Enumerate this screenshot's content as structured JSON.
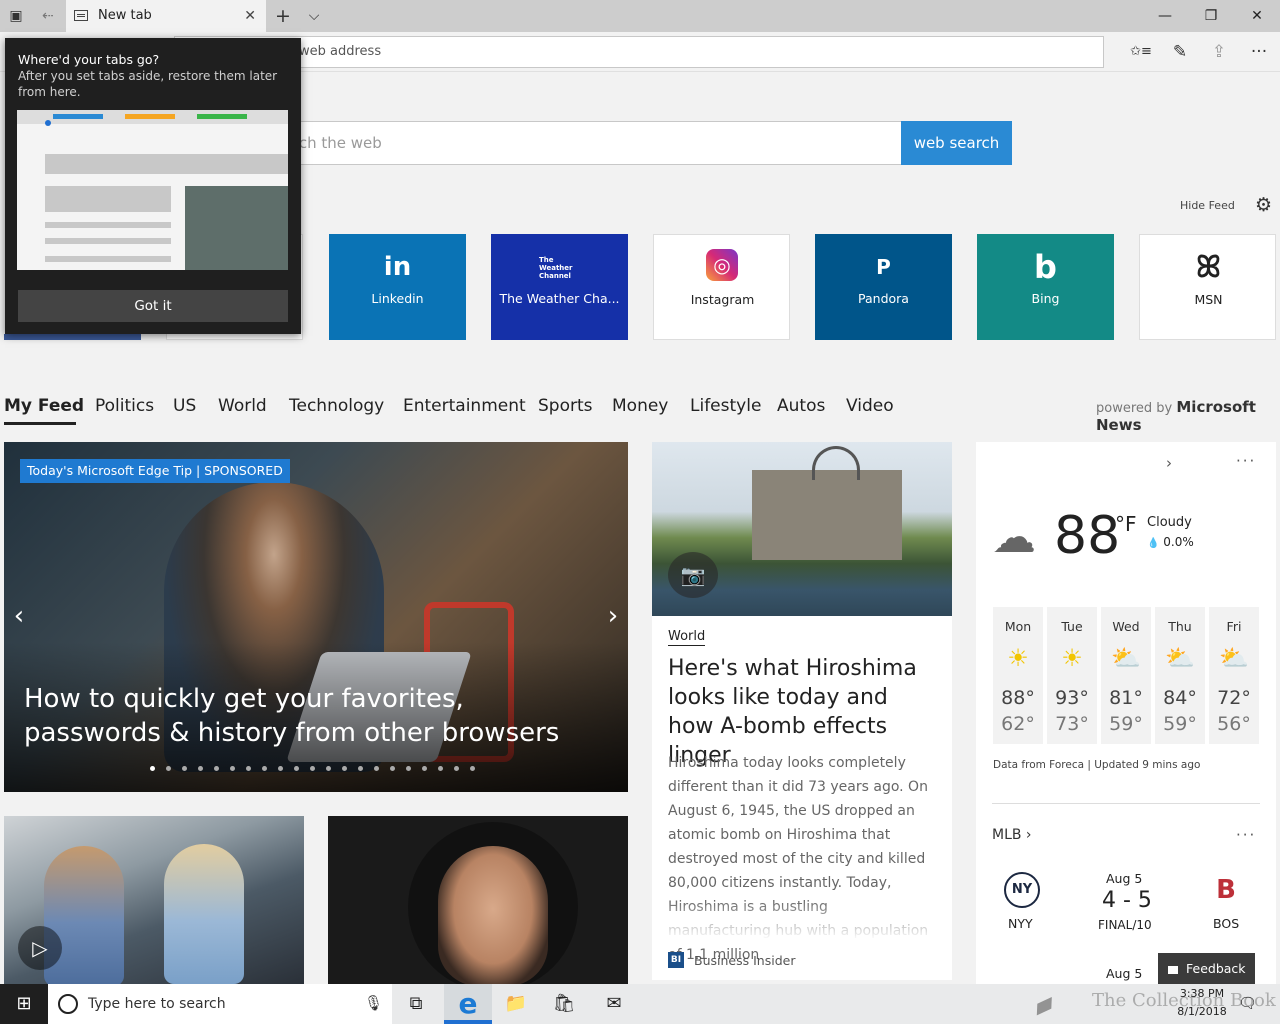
{
  "tab": {
    "title": "New tab",
    "close": "✕"
  },
  "tabstrip": {
    "new_tab": "+",
    "list": "⌵",
    "set_aside": "▣",
    "restore": "⇠"
  },
  "window": {
    "minimize": "—",
    "restore": "❐",
    "close": "✕"
  },
  "address": {
    "placeholder": "web address"
  },
  "toolbar": {
    "favorites_icon": "✩≡",
    "notes_icon": "✎",
    "share_icon": "⇪",
    "more_icon": "···"
  },
  "search": {
    "placeholder": "rch the web",
    "button": "web search"
  },
  "feed_controls": {
    "hide_feed": "Hide Feed",
    "gear_icon": "⚙"
  },
  "tiles": [
    {
      "name": "Linkedin",
      "logo": "in",
      "bg": "#0a73b5",
      "fg": "#ffffff"
    },
    {
      "name": "The Weather Cha...",
      "logo": "The Weather Channel",
      "bg": "#1530a8",
      "fg": "#ffffff"
    },
    {
      "name": "Instagram",
      "logo": "◎",
      "bg": "#ffffff",
      "fg": "#222222"
    },
    {
      "name": "Pandora",
      "logo": "P",
      "bg": "#00558a",
      "fg": "#ffffff"
    },
    {
      "name": "Bing",
      "logo": "b",
      "bg": "#138a86",
      "fg": "#ffffff"
    },
    {
      "name": "MSN",
      "logo": "ꕤ",
      "bg": "#ffffff",
      "fg": "#222222"
    }
  ],
  "nav": [
    "My Feed",
    "Politics",
    "US",
    "World",
    "Technology",
    "Entertainment",
    "Sports",
    "Money",
    "Lifestyle",
    "Autos",
    "Video"
  ],
  "powered": {
    "prefix": "powered by",
    "brand": "Microsoft News"
  },
  "hero": {
    "badge": "Today's Microsoft Edge Tip | SPONSORED",
    "title": "How to quickly get your favorites, passwords & history from other browsers",
    "prev": "‹",
    "next": "›",
    "slide_count": 21,
    "active_slide": 1
  },
  "article": {
    "category": "World",
    "title": "Here's what Hiroshima looks like today and how A-bomb effects linger",
    "body": "Hiroshima today looks completely different than it did 73 years ago. On August 6, 1945, the US dropped an atomic bomb on Hiroshima that destroyed most of the city and killed 80,000 citizens instantly. Today, Hiroshima is a bustling manufacturing hub with a population of 1.1 million",
    "source_logo": "BI",
    "source": "Business Insider",
    "camera_icon": "📷"
  },
  "weather": {
    "chevron": "›",
    "more": "···",
    "cloud_icon": "☁",
    "temp": "88",
    "unit": "°F",
    "condition": "Cloudy",
    "precip": "0.0%",
    "drop_icon": "💧",
    "days": [
      {
        "name": "Mon",
        "icon": "☀",
        "hi": "88°",
        "lo": "62°"
      },
      {
        "name": "Tue",
        "icon": "☀",
        "hi": "93°",
        "lo": "73°"
      },
      {
        "name": "Wed",
        "icon": "⛅",
        "hi": "81°",
        "lo": "59°"
      },
      {
        "name": "Thu",
        "icon": "⛅",
        "hi": "84°",
        "lo": "59°"
      },
      {
        "name": "Fri",
        "icon": "⛅",
        "hi": "72°",
        "lo": "56°"
      }
    ],
    "source": "Data from Foreca | Updated 9 mins ago",
    "sun_color": "#f2c500"
  },
  "mlb": {
    "title": "MLB ›",
    "more": "···",
    "home": "NYY",
    "home_logo": "NY",
    "away": "BOS",
    "away_logo": "B",
    "date": "Aug 5",
    "score": "4 - 5",
    "status": "FINAL/10",
    "next_date": "Aug 5"
  },
  "feedback": {
    "label": "Feedback"
  },
  "popup": {
    "title": "Where'd your tabs go?",
    "body": "After you set tabs aside, restore them later from here.",
    "button": "Got it"
  },
  "taskbar": {
    "start_icon": "⊞",
    "search_placeholder": "Type here to search",
    "mic_icon": "🎙",
    "task_view_icon": "⧉",
    "explorer_icon": "📁",
    "store_icon": "🛍",
    "mail_icon": "✉",
    "edge_icon": "e",
    "time": "3:38 PM",
    "date": "8/1/2018",
    "notif_icon": "🗨",
    "watermark": "The Collection Book"
  },
  "colors": {
    "accent": "#2a8ad4",
    "edge_blue": "#1c7ad4"
  }
}
